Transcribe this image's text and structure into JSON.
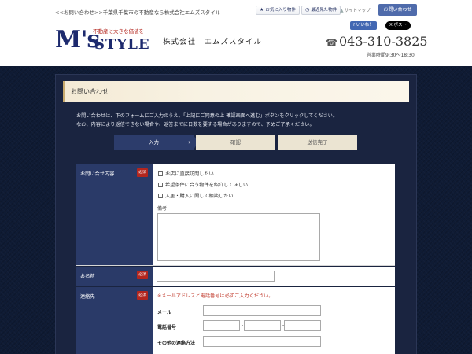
{
  "header": {
    "breadcrumb": "<<お問い合わせ>>千葉県千葉市の不動産なら株式会社エムズスタイル",
    "favorites_label": "お気に入り物件",
    "recent_label": "最近見た物件",
    "sitemap_label": "サイトマップ",
    "contact_label": "お問い合わせ",
    "logo_main": "M's",
    "logo_style": "STYLE",
    "logo_tagline": "不動産に大きな価値を",
    "company": "株式会社　エムズスタイル",
    "fb_like": "いいね！",
    "x_post": "ポスト",
    "phone": "043-310-3825",
    "hours": "営業時間9:30～18:30"
  },
  "page": {
    "heading": "お問い合わせ",
    "intro_line1": "お問い合わせは、下のフォームにご入力のうえ、「上記にご同意の上 確認画面へ進む」ボタンをクリックしてください。",
    "intro_line2": "なお、内容により返信できない場合や、返答までに日数を要する場合がありますので、予めご了承ください。"
  },
  "steps": {
    "step1": "入力",
    "step2": "確認",
    "step3": "送信完了",
    "active_index": 1
  },
  "form": {
    "required_badge": "必須",
    "inquiry": {
      "label": "お問い合せ内容",
      "options": [
        "お店に直接訪問したい",
        "希望条件に合う物件を紹介してほしい",
        "入居・購入に関して相談したい"
      ],
      "remark_label": "備考"
    },
    "name": {
      "label": "お名前"
    },
    "contact": {
      "label": "連絡先",
      "notice": "※メールアドレスと電話番号は必ずご入力ください。",
      "email_label": "メール",
      "phone_label": "電話番号",
      "phone_separator": "-",
      "other_label": "その他の連絡方法"
    }
  },
  "colors": {
    "brand_navy": "#1d2a6e",
    "header_cell": "#2a3a68",
    "required_red": "#b3261e",
    "step_active": "#2c3c6b",
    "step_inactive": "#ebe4d2"
  }
}
